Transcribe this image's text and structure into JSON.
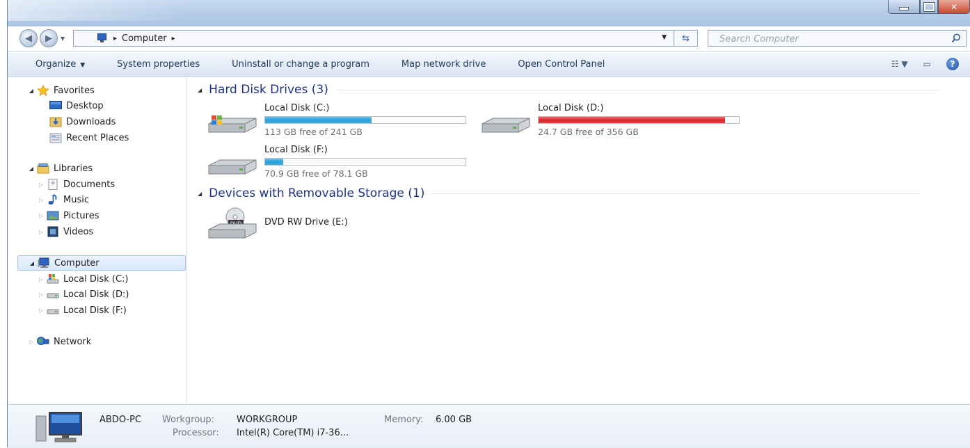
{
  "window": {
    "title": "Computer"
  },
  "address_bar": {
    "breadcrumb": [
      "Computer"
    ],
    "search_placeholder": "Search Computer"
  },
  "toolbar": {
    "organize": "Organize",
    "system_properties": "System properties",
    "uninstall": "Uninstall or change a program",
    "map_network": "Map network drive",
    "open_control_panel": "Open Control Panel"
  },
  "sidebar": {
    "favorites": {
      "label": "Favorites",
      "items": [
        "Desktop",
        "Downloads",
        "Recent Places"
      ]
    },
    "libraries": {
      "label": "Libraries",
      "items": [
        "Documents",
        "Music",
        "Pictures",
        "Videos"
      ]
    },
    "computer": {
      "label": "Computer",
      "items": [
        "Local Disk (C:)",
        "Local Disk (D:)",
        "Local Disk (F:)"
      ]
    },
    "network": {
      "label": "Network"
    }
  },
  "content": {
    "hard_disks": {
      "title": "Hard Disk Drives (3)",
      "drives": [
        {
          "name": "Local Disk (C:)",
          "free_text": "113 GB free of 241 GB",
          "used_fraction": 0.53,
          "bar_color": "#26a0da"
        },
        {
          "name": "Local Disk (D:)",
          "free_text": "24.7 GB free of 356 GB",
          "used_fraction": 0.93,
          "bar_color": "#da2626"
        },
        {
          "name": "Local Disk (F:)",
          "free_text": "70.9 GB free of 78.1 GB",
          "used_fraction": 0.09,
          "bar_color": "#26a0da"
        }
      ]
    },
    "removable": {
      "title": "Devices with Removable Storage (1)",
      "devices": [
        {
          "name": "DVD RW Drive (E:)",
          "icon_text": "DVD"
        }
      ]
    }
  },
  "details_pane": {
    "computer_name": "ABDO-PC",
    "workgroup_label": "Workgroup:",
    "workgroup_value": "WORKGROUP",
    "memory_label": "Memory:",
    "memory_value": "6.00 GB",
    "processor_label": "Processor:",
    "processor_value": "Intel(R) Core(TM) i7-36..."
  }
}
